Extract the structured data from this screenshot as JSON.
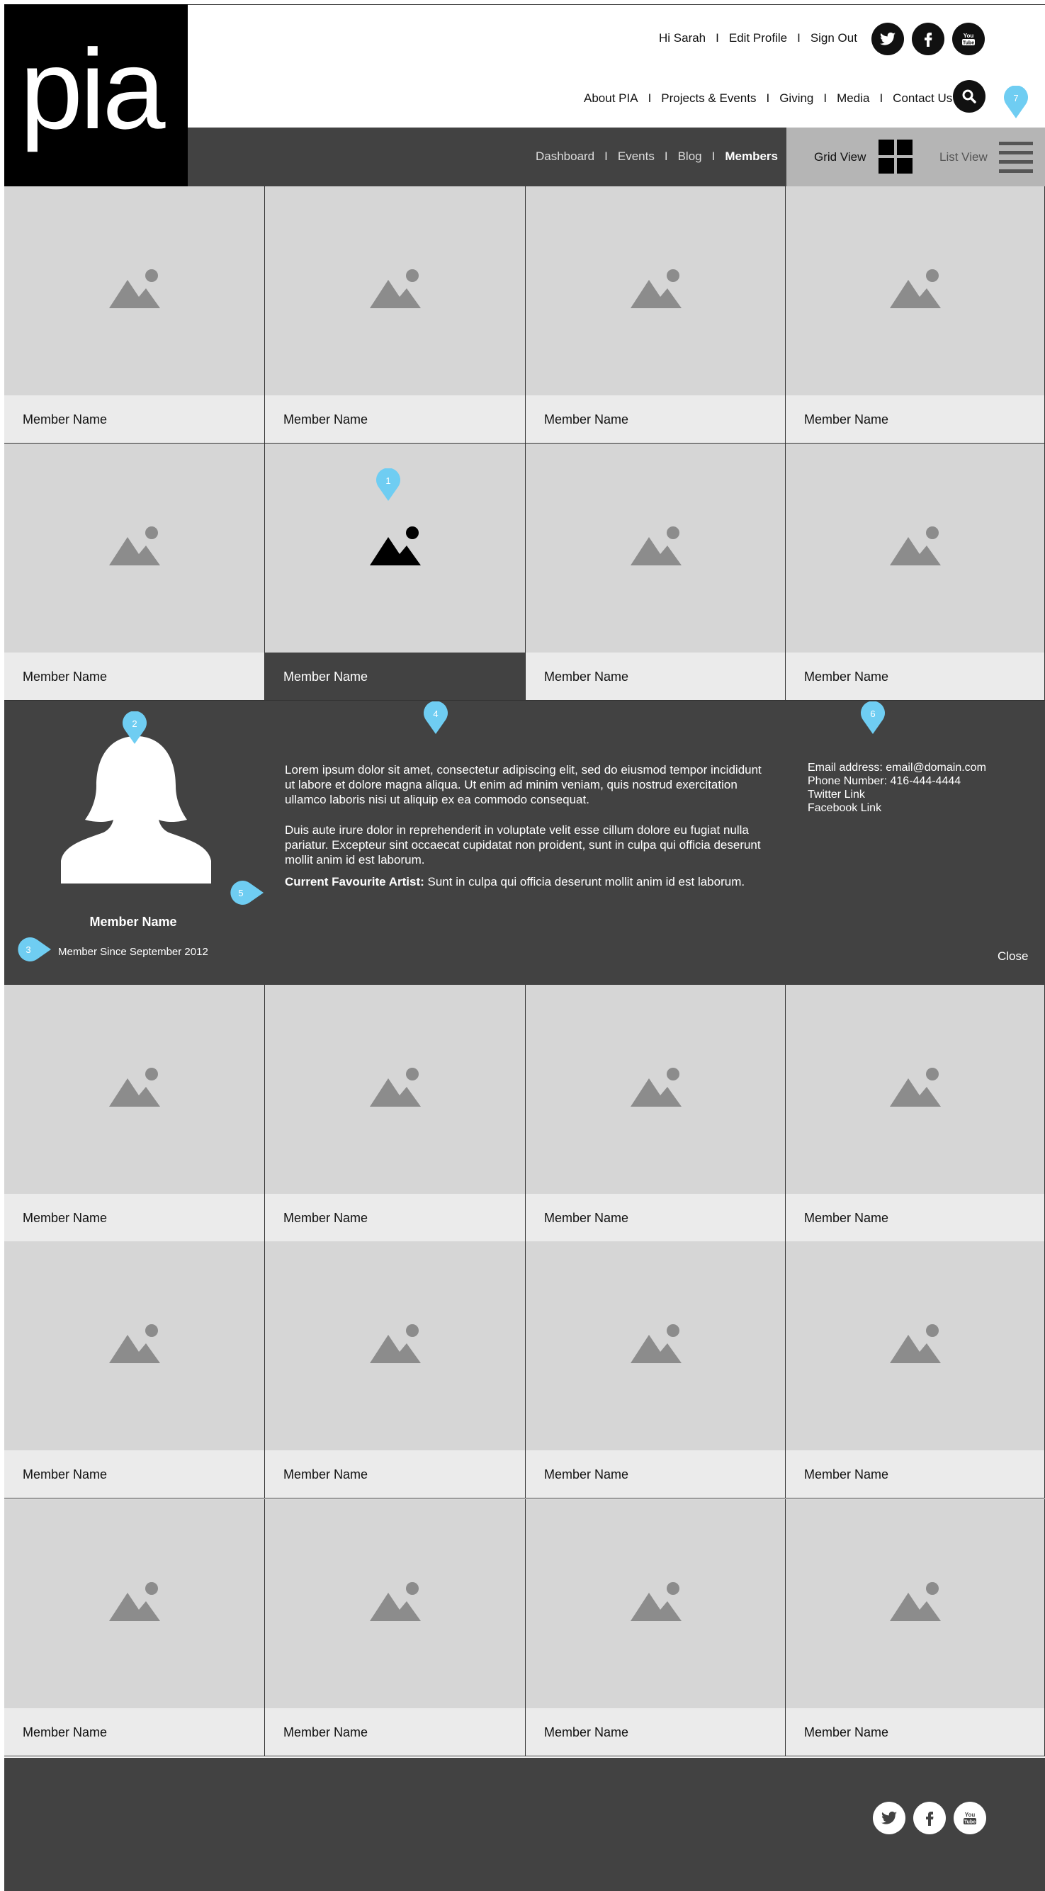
{
  "logo": {
    "text": "pia"
  },
  "utility": {
    "greeting": "Hi Sarah",
    "edit_profile": "Edit Profile",
    "sign_out": "Sign Out",
    "separator": "I"
  },
  "social": {
    "twitter": "twitter-icon",
    "facebook": "facebook-icon",
    "youtube_label": "You Tube"
  },
  "main_nav": {
    "items": [
      "About PIA",
      "Projects & Events",
      "Giving",
      "Media",
      "Contact Us"
    ]
  },
  "sub_nav": {
    "items": [
      "Dashboard",
      "Events",
      "Blog",
      "Members"
    ],
    "active": "Members"
  },
  "view_toggle": {
    "grid_label": "Grid View",
    "list_label": "List View"
  },
  "member_label": "Member Name",
  "expanded": {
    "name": "Member Name",
    "since": "Member Since September 2012",
    "para1": "Lorem ipsum dolor sit amet, consectetur adipiscing elit, sed do eiusmod tempor incididunt ut labore et dolore magna aliqua. Ut enim ad minim veniam, quis nostrud exercitation ullamco laboris nisi ut aliquip ex ea commodo consequat.",
    "para2": "Duis aute irure dolor in reprehenderit in voluptate velit esse cillum dolore eu fugiat nulla pariatur. Excepteur sint occaecat cupidatat non proident, sunt in culpa qui officia deserunt mollit anim id est laborum.",
    "artist_label": "Current Favourite Artist:",
    "artist_value": " Sunt in culpa qui officia deserunt mollit anim id est laborum.",
    "email": "Email address: email@domain.com",
    "phone": "Phone Number: 416-444-4444",
    "twitter": "Twitter Link",
    "facebook": "Facebook Link",
    "close": "Close"
  },
  "pins": [
    "1",
    "2",
    "3",
    "4",
    "5",
    "6",
    "7"
  ],
  "colors": {
    "dark": "#424242",
    "tile": "#d6d6d6",
    "label_bg": "#ebebeb",
    "pin": "#6fcdf2"
  }
}
